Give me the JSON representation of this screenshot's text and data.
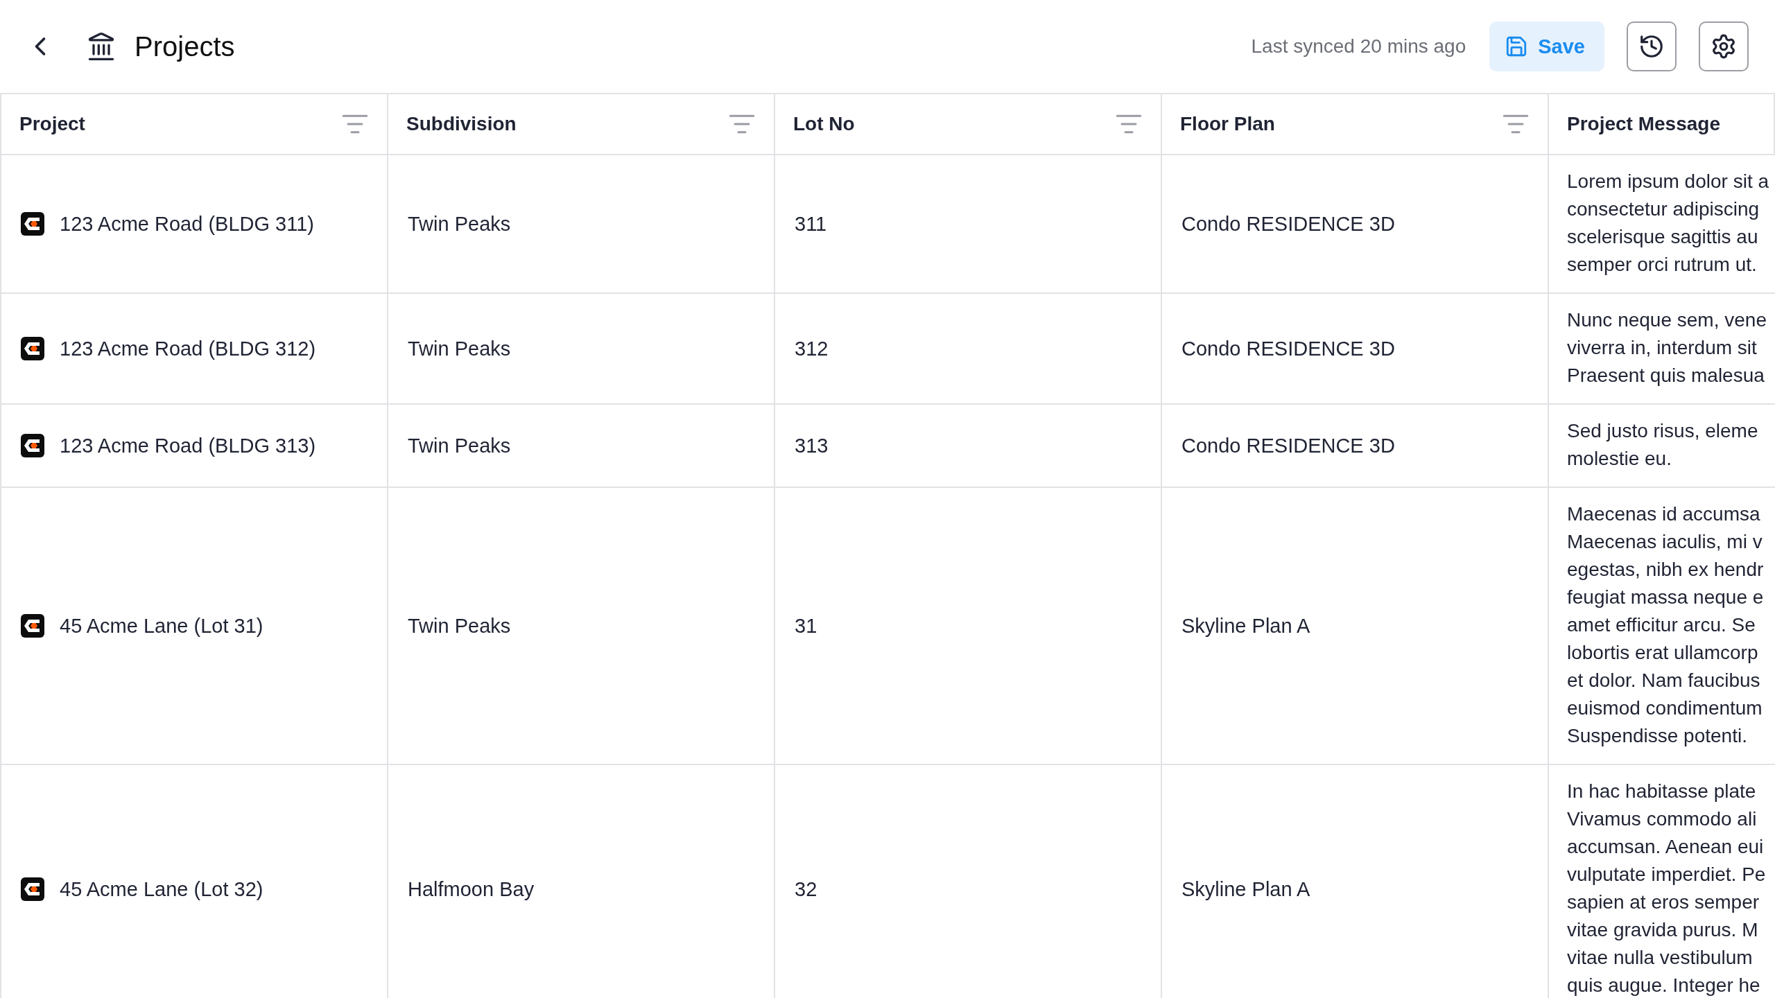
{
  "header": {
    "title": "Projects",
    "sync_status": "Last synced 20 mins ago",
    "save_label": "Save"
  },
  "table": {
    "columns": [
      {
        "label": "Project",
        "filterable": true
      },
      {
        "label": "Subdivision",
        "filterable": true
      },
      {
        "label": "Lot No",
        "filterable": true
      },
      {
        "label": "Floor Plan",
        "filterable": true
      },
      {
        "label": "Project Message",
        "filterable": false
      }
    ],
    "rows": [
      {
        "project": "123 Acme Road (BLDG 311)",
        "subdivision": "Twin Peaks",
        "lot_no": "311",
        "floor_plan": "Condo RESIDENCE 3D",
        "message": [
          "Lorem ipsum dolor sit a",
          "consectetur adipiscing",
          "scelerisque sagittis au",
          "semper orci rutrum ut."
        ]
      },
      {
        "project": "123 Acme Road (BLDG 312)",
        "subdivision": "Twin Peaks",
        "lot_no": "312",
        "floor_plan": "Condo RESIDENCE 3D",
        "message": [
          "Nunc neque sem, vene",
          "viverra in, interdum sit",
          "Praesent quis malesua"
        ]
      },
      {
        "project": "123 Acme Road (BLDG 313)",
        "subdivision": "Twin Peaks",
        "lot_no": "313",
        "floor_plan": "Condo RESIDENCE 3D",
        "message": [
          "Sed justo risus, eleme",
          "molestie eu."
        ]
      },
      {
        "project": "45 Acme Lane (Lot 31)",
        "subdivision": "Twin Peaks",
        "lot_no": "31",
        "floor_plan": "Skyline Plan A",
        "message": [
          "Maecenas id accumsa",
          "Maecenas iaculis, mi v",
          "egestas, nibh ex hendr",
          "feugiat massa neque e",
          "amet efficitur arcu. Se",
          "lobortis erat ullamcorp",
          "et dolor. Nam faucibus",
          "euismod condimentum",
          "Suspendisse potenti."
        ]
      },
      {
        "project": "45 Acme Lane (Lot 32)",
        "subdivision": "Halfmoon Bay",
        "lot_no": "32",
        "floor_plan": "Skyline Plan A",
        "message": [
          "In hac habitasse plate",
          "Vivamus commodo ali",
          "accumsan. Aenean eui",
          "vulputate imperdiet. Pe",
          "sapien at eros semper",
          "vitae gravida purus. M",
          "vitae nulla vestibulum",
          "quis augue. Integer he"
        ]
      }
    ]
  }
}
